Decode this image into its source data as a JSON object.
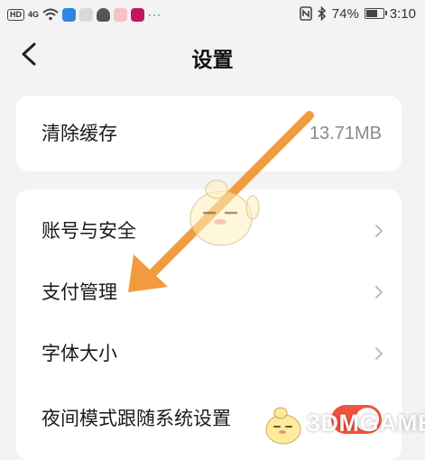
{
  "status_bar": {
    "hd": "HD",
    "signal": "4G",
    "more": "···",
    "battery": "74%",
    "time": "3:10",
    "battery_level": 0.74
  },
  "header": {
    "title": "设置"
  },
  "cache": {
    "label": "清除缓存",
    "value": "13.71MB"
  },
  "settings": {
    "items": [
      {
        "label": "账号与安全"
      },
      {
        "label": "支付管理"
      },
      {
        "label": "字体大小"
      },
      {
        "label": "夜间模式跟随系统设置",
        "toggle_on": true
      }
    ]
  },
  "watermark": {
    "text": "3DMGAME"
  },
  "colors": {
    "accent_toggle": "#f0533f",
    "arrow": "#f29b3e",
    "background": "#f3f3f3",
    "card": "#ffffff"
  }
}
